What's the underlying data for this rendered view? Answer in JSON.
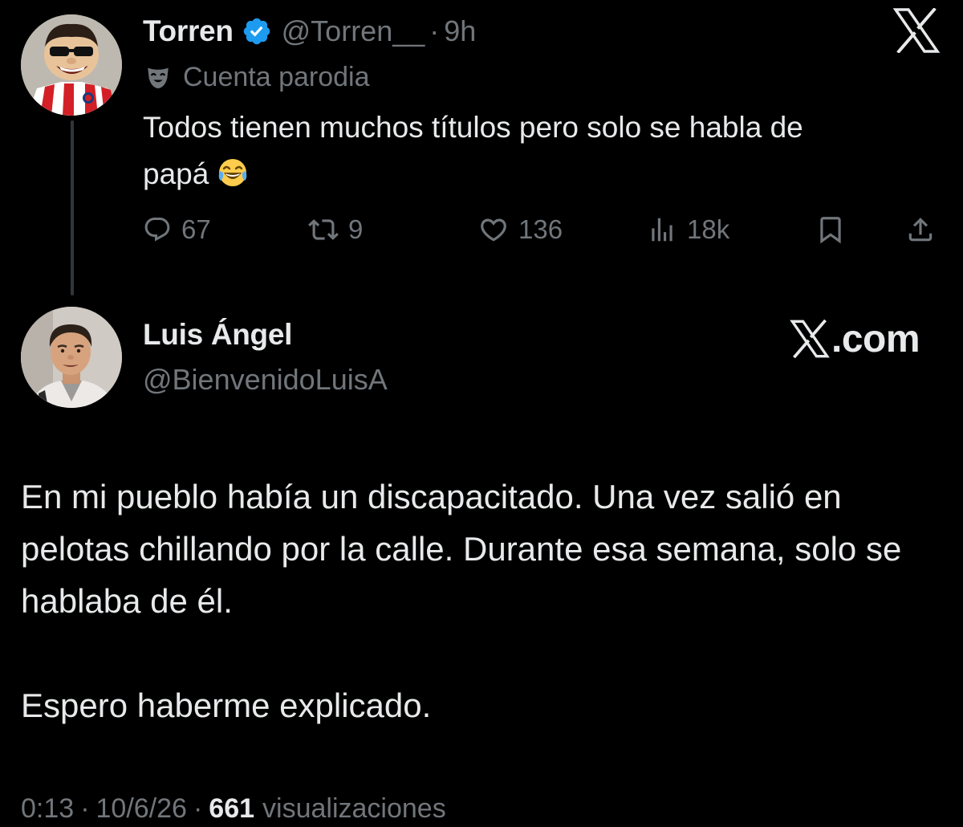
{
  "tweet": {
    "author": {
      "display_name": "Torren",
      "handle": "@Torren__",
      "separator": "·",
      "time": "9h",
      "verified": true,
      "parody_label": "Cuenta parodia"
    },
    "text_line1": "Todos tienen muchos títulos pero solo se habla de",
    "text_line2": "papá",
    "emoji": "face-with-tears-of-joy",
    "stats": {
      "replies": "67",
      "reposts": "9",
      "likes": "136",
      "views": "18k"
    }
  },
  "reply": {
    "author": {
      "display_name": "Luis Ángel",
      "handle": "@BienvenidoLuisA"
    },
    "source_label": ".com",
    "paragraph1": "En mi pueblo había un discapacitado. Una vez salió en pelotas chillando por la calle. Durante esa semana, solo se hablaba de él.",
    "paragraph2": "Espero haberme explicado.",
    "footer": {
      "time": "0:13",
      "separator": "·",
      "date": "10/6/26",
      "views_count": "661",
      "views_label": "visualizaciones"
    }
  },
  "colors": {
    "background": "#000000",
    "primary_text": "#e7e9ea",
    "secondary_text": "#71767b",
    "verified_blue": "#1d9bf0",
    "thread_line": "#333639"
  },
  "icons": [
    "x-logo-icon",
    "verified-badge-icon",
    "parody-mask-icon",
    "reply-icon",
    "repost-icon",
    "like-icon",
    "views-icon",
    "bookmark-icon",
    "share-icon"
  ]
}
